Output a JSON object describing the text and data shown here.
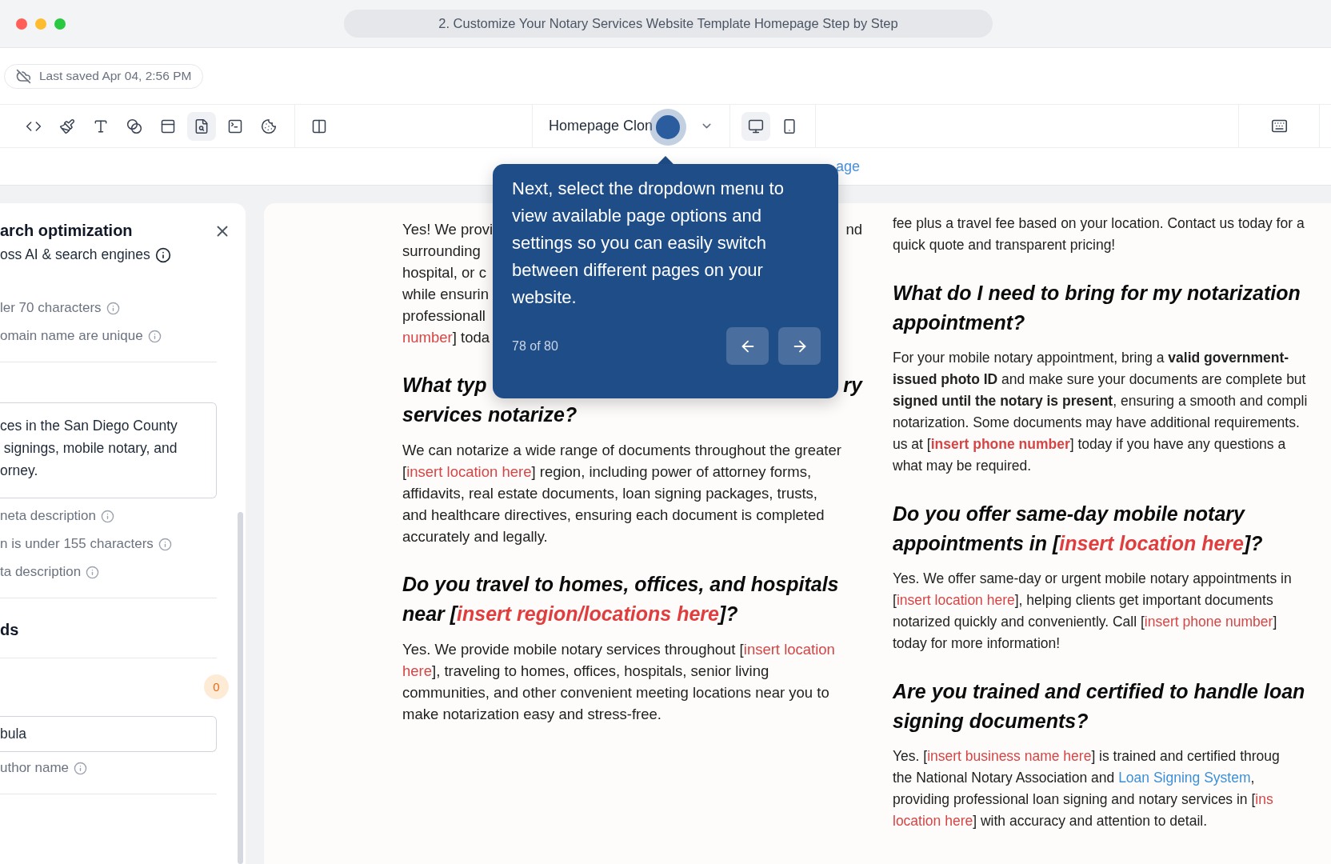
{
  "window": {
    "title": "2. Customize Your Notary Services Website Template Homepage Step by Step"
  },
  "save_status": "Last saved Apr 04, 2:56 PM",
  "toolbar": {
    "tools": [
      {
        "kind": "code",
        "selected": false
      },
      {
        "kind": "brush",
        "selected": false
      },
      {
        "kind": "text",
        "selected": false
      },
      {
        "kind": "blend",
        "selected": false
      },
      {
        "kind": "layout",
        "selected": false
      },
      {
        "kind": "seo",
        "selected": true
      },
      {
        "kind": "terminal",
        "selected": false
      },
      {
        "kind": "cookie",
        "selected": false
      },
      {
        "kind": "columns",
        "selected": false
      }
    ],
    "page_select": "Homepage Clon",
    "devices": [
      {
        "kind": "desktop",
        "selected": true
      },
      {
        "kind": "mobile",
        "selected": false
      }
    ]
  },
  "url_fragment": "age",
  "seo_panel": {
    "title": "arch optimization",
    "subtitle": "oss AI & search engines",
    "title_checks": [
      "ler 70 characters",
      "omain name are unique"
    ],
    "description_lines": [
      "ces in the San Diego County",
      " signings, mobile notary, and",
      "orney."
    ],
    "description_checks": [
      "neta description",
      "n is under 155 characters",
      "ta description"
    ],
    "keywords_heading": "ds",
    "keywords_count": "0",
    "author_value": "bula",
    "author_check": "uthor name"
  },
  "tour": {
    "text": "Next, select the dropdown menu to view available page options and settings so you can easily switch between different pages on your website.",
    "step": "78 of 80"
  },
  "columns": [
    [
      {
        "kind": "paragraph",
        "lines": [
          [
            {
              "text": "Yes! We provi"
            },
            {
              "text": "nd",
              "kind": "tail"
            }
          ],
          [
            {
              "text": "surrounding"
            }
          ],
          [
            {
              "text": "hospital, or c"
            }
          ],
          [
            {
              "text": "while ensurin"
            }
          ],
          [
            {
              "text": "professionall"
            }
          ],
          [
            {
              "text": "number",
              "kind": "placeholder"
            },
            {
              "text": "] toda"
            }
          ]
        ]
      },
      {
        "kind": "heading",
        "lines": [
          [
            {
              "text": "What typ"
            },
            {
              "text": "ry",
              "kind": "tail"
            }
          ],
          [
            {
              "text": "services notarize?"
            }
          ]
        ]
      },
      {
        "kind": "paragraph",
        "lines": [
          [
            {
              "text": "We can notarize a wide range of documents throughout the greater"
            }
          ],
          [
            {
              "text": "["
            },
            {
              "text": "insert location here",
              "kind": "placeholder"
            },
            {
              "text": "] region, including power of attorney forms,"
            }
          ],
          [
            {
              "text": "affidavits, real estate documents, loan signing packages, trusts,"
            }
          ],
          [
            {
              "text": "and healthcare directives, ensuring each document is completed"
            }
          ],
          [
            {
              "text": "accurately and legally."
            }
          ]
        ]
      },
      {
        "kind": "heading",
        "lines": [
          [
            {
              "text": "Do you travel to homes, offices, and hospitals"
            }
          ],
          [
            {
              "text": "near ["
            },
            {
              "text": "insert region/locations here",
              "kind": "placeholder"
            },
            {
              "text": "]?"
            }
          ]
        ]
      },
      {
        "kind": "paragraph",
        "lines": [
          [
            {
              "text": "Yes. We provide mobile notary services throughout ["
            },
            {
              "text": "insert location",
              "kind": "placeholder"
            }
          ],
          [
            {
              "text": "here",
              "kind": "placeholder"
            },
            {
              "text": "], traveling to homes, offices, hospitals, senior living"
            }
          ],
          [
            {
              "text": "communities, and other convenient meeting locations near you to"
            }
          ],
          [
            {
              "text": "make notarization easy and stress-free."
            }
          ]
        ]
      }
    ],
    [
      {
        "kind": "paragraph",
        "lines": [
          [
            {
              "text": "fee plus a travel fee based on your location. Contact us today for a"
            }
          ],
          [
            {
              "text": "quick quote and transparent pricing!"
            }
          ]
        ]
      },
      {
        "kind": "heading",
        "lines": [
          [
            {
              "text": "What do I need to bring for my notarization"
            }
          ],
          [
            {
              "text": "appointment?"
            }
          ]
        ]
      },
      {
        "kind": "paragraph",
        "lines": [
          [
            {
              "text": "For your mobile notary appointment, bring a "
            },
            {
              "text": "valid government-",
              "kind": "bold"
            }
          ],
          [
            {
              "text": "issued photo ID",
              "kind": "bold"
            },
            {
              "text": " and make sure your documents are complete but"
            }
          ],
          [
            {
              "text": "signed until the notary is present",
              "kind": "bold"
            },
            {
              "text": ", ensuring a smooth and compli"
            }
          ],
          [
            {
              "text": "notarization. Some documents may have additional requirements."
            }
          ],
          [
            {
              "text": "us at ["
            },
            {
              "text": "insert phone number",
              "kind": "bold_placeholder"
            },
            {
              "text": "] today if you have any questions a"
            }
          ],
          [
            {
              "text": "what may be required."
            }
          ]
        ]
      },
      {
        "kind": "heading",
        "lines": [
          [
            {
              "text": "Do you offer same-day mobile notary"
            }
          ],
          [
            {
              "text": "appointments in ["
            },
            {
              "text": "insert location here",
              "kind": "placeholder"
            },
            {
              "text": "]?"
            }
          ]
        ]
      },
      {
        "kind": "paragraph",
        "lines": [
          [
            {
              "text": "Yes. We offer same-day or urgent mobile notary appointments in"
            }
          ],
          [
            {
              "text": "["
            },
            {
              "text": "insert location here",
              "kind": "placeholder"
            },
            {
              "text": "], helping clients get important documents"
            }
          ],
          [
            {
              "text": "notarized quickly and conveniently. Call ["
            },
            {
              "text": "insert phone number",
              "kind": "placeholder"
            },
            {
              "text": "]"
            }
          ],
          [
            {
              "text": "today for more information!"
            }
          ]
        ]
      },
      {
        "kind": "heading",
        "lines": [
          [
            {
              "text": "Are you trained and certified to handle loan"
            }
          ],
          [
            {
              "text": "signing documents?"
            }
          ]
        ]
      },
      {
        "kind": "paragraph",
        "lines": [
          [
            {
              "text": "Yes. ["
            },
            {
              "text": "insert business name here",
              "kind": "placeholder"
            },
            {
              "text": "] is trained and certified throug"
            }
          ],
          [
            {
              "text": "the National Notary Association and "
            },
            {
              "text": "Loan Signing System",
              "kind": "link"
            },
            {
              "text": ","
            }
          ],
          [
            {
              "text": "providing professional loan signing and notary services in ["
            },
            {
              "text": "ins",
              "kind": "placeholder"
            }
          ],
          [
            {
              "text": "location here",
              "kind": "placeholder"
            },
            {
              "text": "] with accuracy and attention to detail."
            }
          ]
        ]
      }
    ]
  ]
}
